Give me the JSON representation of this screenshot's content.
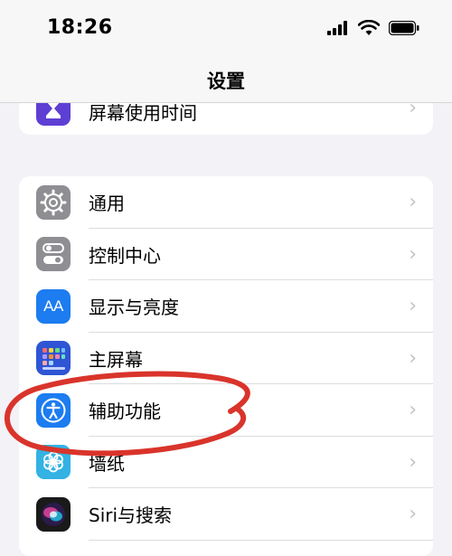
{
  "status": {
    "time": "18:26"
  },
  "nav": {
    "title": "设置"
  },
  "top_card": {
    "item_label": "屏幕使用时间",
    "icon": "hourglass-icon"
  },
  "items": [
    {
      "label": "通用",
      "icon": "gear-icon",
      "color": "#8e8e93"
    },
    {
      "label": "控制中心",
      "icon": "toggles-icon",
      "color": "#8e8e93"
    },
    {
      "label": "显示与亮度",
      "icon": "AA",
      "color": "#1c7cf0"
    },
    {
      "label": "主屏幕",
      "icon": "home-grid-icon",
      "color": "#2f55d4"
    },
    {
      "label": "辅助功能",
      "icon": "accessibility-icon",
      "color": "#1c7cf0"
    },
    {
      "label": "墙纸",
      "icon": "flower-icon",
      "color": "#33b2e3"
    },
    {
      "label": "Siri与搜索",
      "icon": "siri-icon",
      "color": "#1a1a1a"
    }
  ],
  "chevron": "›",
  "annotation_color": "#d9342b"
}
